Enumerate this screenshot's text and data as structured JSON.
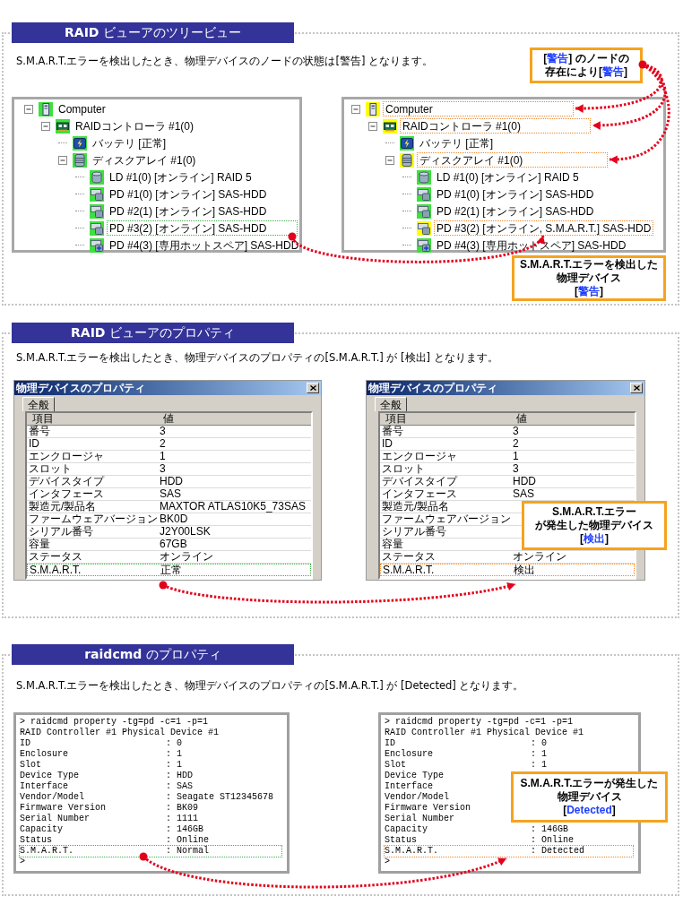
{
  "sections": [
    {
      "kind": "tree",
      "header": "**RAID** ビューアのツリービュー",
      "description": "S.M.A.R.T.エラーを検出したとき、物理デバイスのノードの状態は[警告] となります。",
      "node_callout": {
        "lines": [
          [
            {
              "text": "[",
              "accent": false
            },
            {
              "text": "警告",
              "accent": true
            },
            {
              "text": "] のノードの",
              "accent": false
            }
          ],
          [
            {
              "text": "存在により[",
              "accent": false
            },
            {
              "text": "警告",
              "accent": true
            },
            {
              "text": "]",
              "accent": false
            }
          ]
        ]
      },
      "panels": [
        {
          "kind": "before",
          "nodes": [
            {
              "label": "Computer",
              "kind": "computer",
              "warning": false,
              "expanded": true,
              "outlined": false,
              "children": [
                {
                  "label": "RAIDコントローラ #1(0)",
                  "kind": "controller",
                  "warning": false,
                  "expanded": true,
                  "outlined": false,
                  "children": [
                    {
                      "label": "バッテリ [正常]",
                      "kind": "battery",
                      "warning": false,
                      "outlined": false
                    },
                    {
                      "label": "ディスクアレイ #1(0)",
                      "kind": "array",
                      "warning": false,
                      "expanded": true,
                      "outlined": false,
                      "children": [
                        {
                          "label": "LD #1(0) [オンライン] RAID 5",
                          "kind": "logical_drive",
                          "warning": false,
                          "outlined": false
                        },
                        {
                          "label": "PD #1(0) [オンライン] SAS-HDD",
                          "kind": "drive",
                          "warning": false,
                          "outlined": false
                        },
                        {
                          "label": "PD #2(1) [オンライン] SAS-HDD",
                          "kind": "drive",
                          "warning": false,
                          "outlined": false
                        },
                        {
                          "label": "PD #3(2) [オンライン] SAS-HDD",
                          "kind": "drive",
                          "warning": false,
                          "outlined": true
                        },
                        {
                          "label": "PD #4(3) [専用ホットスペア] SAS-HDD",
                          "kind": "spare",
                          "warning": false,
                          "outlined": false
                        }
                      ]
                    }
                  ]
                }
              ]
            }
          ]
        },
        {
          "kind": "after",
          "nodes": [
            {
              "label": "Computer",
              "kind": "computer",
              "warning": true,
              "expanded": true,
              "outlined": true,
              "children": [
                {
                  "label": "RAIDコントローラ #1(0)",
                  "kind": "controller",
                  "warning": true,
                  "expanded": true,
                  "outlined": true,
                  "children": [
                    {
                      "label": "バッテリ [正常]",
                      "kind": "battery",
                      "warning": false,
                      "outlined": false
                    },
                    {
                      "label": "ディスクアレイ #1(0)",
                      "kind": "array",
                      "warning": true,
                      "expanded": true,
                      "outlined": true,
                      "children": [
                        {
                          "label": "LD #1(0) [オンライン] RAID 5",
                          "kind": "logical_drive",
                          "warning": false,
                          "outlined": false
                        },
                        {
                          "label": "PD #1(0) [オンライン] SAS-HDD",
                          "kind": "drive",
                          "warning": false,
                          "outlined": false
                        },
                        {
                          "label": "PD #2(1) [オンライン] SAS-HDD",
                          "kind": "drive",
                          "warning": false,
                          "outlined": false
                        },
                        {
                          "label": "PD #3(2) [オンライン, S.M.A.R.T.] SAS-HDD",
                          "kind": "drive",
                          "warning": true,
                          "outlined": true
                        },
                        {
                          "label": "PD #4(3) [専用ホットスペア] SAS-HDD",
                          "kind": "spare",
                          "warning": false,
                          "outlined": false
                        }
                      ]
                    }
                  ]
                }
              ]
            }
          ]
        }
      ],
      "device_callout": {
        "lines": [
          [
            {
              "text": "S.M.A.R.T.エラーを検出した",
              "accent": false
            }
          ],
          [
            {
              "text": "物理デバイス",
              "accent": false
            }
          ],
          [
            {
              "text": "[",
              "accent": false
            },
            {
              "text": "警告",
              "accent": true
            },
            {
              "text": "]",
              "accent": false
            }
          ]
        ]
      }
    },
    {
      "kind": "dialog",
      "header": "**RAID** ビューアのプロパティ",
      "description": "S.M.A.R.T.エラーを検出したとき、物理デバイスのプロパティの[S.M.A.R.T.] が [検出] となります。",
      "panels": [
        {
          "kind": "before",
          "title": "物理デバイスのプロパティ",
          "tabs": [
            {
              "label": "全般",
              "selected": true
            }
          ],
          "columns": [
            "項目",
            "値"
          ],
          "rows": [
            {
              "name": "番号",
              "value": "3",
              "outlined": false
            },
            {
              "name": "ID",
              "value": "2",
              "outlined": false
            },
            {
              "name": "エンクロージャ",
              "value": "1",
              "outlined": false
            },
            {
              "name": "スロット",
              "value": "3",
              "outlined": false
            },
            {
              "name": "デバイスタイプ",
              "value": "HDD",
              "outlined": false
            },
            {
              "name": "インタフェース",
              "value": "SAS",
              "outlined": false
            },
            {
              "name": "製造元/製品名",
              "value": "MAXTOR ATLAS10K5_73SAS",
              "outlined": false
            },
            {
              "name": "ファームウェアバージョン",
              "value": "BK0D",
              "outlined": false
            },
            {
              "name": "シリアル番号",
              "value": "J2Y00LSK",
              "outlined": false
            },
            {
              "name": "容量",
              "value": "67GB",
              "outlined": false
            },
            {
              "name": "ステータス",
              "value": "オンライン",
              "outlined": false
            },
            {
              "name": "S.M.A.R.T.",
              "value": "正常",
              "outlined": true
            }
          ]
        },
        {
          "kind": "after",
          "title": "物理デバイスのプロパティ",
          "tabs": [
            {
              "label": "全般",
              "selected": true
            }
          ],
          "columns": [
            "項目",
            "値"
          ],
          "rows": [
            {
              "name": "番号",
              "value": "3",
              "outlined": false
            },
            {
              "name": "ID",
              "value": "2",
              "outlined": false
            },
            {
              "name": "エンクロージャ",
              "value": "1",
              "outlined": false
            },
            {
              "name": "スロット",
              "value": "3",
              "outlined": false
            },
            {
              "name": "デバイスタイプ",
              "value": "HDD",
              "outlined": false
            },
            {
              "name": "インタフェース",
              "value": "SAS",
              "outlined": false
            },
            {
              "name": "製造元/製品名",
              "outlined": false
            },
            {
              "name": "ファームウェアバージョン",
              "outlined": false
            },
            {
              "name": "シリアル番号",
              "outlined": false
            },
            {
              "name": "容量",
              "outlined": false
            },
            {
              "name": "ステータス",
              "value": "オンライン",
              "outlined": false
            },
            {
              "name": "S.M.A.R.T.",
              "value": "検出",
              "outlined": true
            }
          ]
        }
      ],
      "device_callout": {
        "lines": [
          [
            {
              "text": "S.M.A.R.T.エラー",
              "accent": false
            }
          ],
          [
            {
              "text": "が発生した物理デバイス",
              "accent": false
            }
          ],
          [
            {
              "text": "[",
              "accent": false
            },
            {
              "text": "検出",
              "accent": true
            },
            {
              "text": "]",
              "accent": false
            }
          ]
        ]
      }
    },
    {
      "kind": "terminal",
      "header": "**raidcmd** のプロパティ",
      "description": "S.M.A.R.T.エラーを検出したとき、物理デバイスのプロパティの[S.M.A.R.T.] が [Detected] となります。",
      "panels": [
        {
          "kind": "before",
          "lines": [
            {
              "kind": "text",
              "text": "> raidcmd property -tg=pd -c=1 -p=1",
              "outlined": false
            },
            {
              "kind": "text",
              "text": "RAID Controller #1 Physical Device #1",
              "outlined": false
            },
            {
              "kind": "field",
              "label": "ID",
              "value": ": 0",
              "outlined": false
            },
            {
              "kind": "field",
              "label": "Enclosure",
              "value": ": 1",
              "outlined": false
            },
            {
              "kind": "field",
              "label": "Slot",
              "value": ": 1",
              "outlined": false
            },
            {
              "kind": "field",
              "label": "Device Type",
              "value": ": HDD",
              "outlined": false
            },
            {
              "kind": "field",
              "label": "Interface",
              "value": ": SAS",
              "outlined": false
            },
            {
              "kind": "field",
              "label": "Vendor/Model",
              "value": ": Seagate ST12345678",
              "outlined": false
            },
            {
              "kind": "field",
              "label": "Firmware Version",
              "value": ": BK09",
              "outlined": false
            },
            {
              "kind": "field",
              "label": "Serial Number",
              "value": ": 1111",
              "outlined": false
            },
            {
              "kind": "field",
              "label": "Capacity",
              "value": ": 146GB",
              "outlined": false
            },
            {
              "kind": "field",
              "label": "Status",
              "value": ": Online",
              "outlined": false
            },
            {
              "kind": "field",
              "label": "S.M.A.R.T.",
              "value": ": Normal",
              "outlined": true
            },
            {
              "kind": "text",
              "text": ">",
              "outlined": false
            }
          ]
        },
        {
          "kind": "after",
          "lines": [
            {
              "kind": "text",
              "text": "> raidcmd property -tg=pd -c=1 -p=1",
              "outlined": false
            },
            {
              "kind": "text",
              "text": "RAID Controller #1 Physical Device #1",
              "outlined": false
            },
            {
              "kind": "field",
              "label": "ID",
              "value": ": 0",
              "outlined": false
            },
            {
              "kind": "field",
              "label": "Enclosure",
              "value": ": 1",
              "outlined": false
            },
            {
              "kind": "field",
              "label": "Slot",
              "value": ": 1",
              "outlined": false
            },
            {
              "kind": "field",
              "label": "Device Type",
              "outlined": false
            },
            {
              "kind": "field",
              "label": "Interface",
              "outlined": false
            },
            {
              "kind": "field",
              "label": "Vendor/Model",
              "outlined": false
            },
            {
              "kind": "field",
              "label": "Firmware Version",
              "outlined": false
            },
            {
              "kind": "field",
              "label": "Serial Number",
              "outlined": false
            },
            {
              "kind": "field",
              "label": "Capacity",
              "value": ": 146GB",
              "outlined": false
            },
            {
              "kind": "field",
              "label": "Status",
              "value": ": Online",
              "outlined": false
            },
            {
              "kind": "field",
              "label": "S.M.A.R.T.",
              "value": ": Detected",
              "outlined": true
            },
            {
              "kind": "text",
              "text": ">",
              "outlined": false
            }
          ]
        }
      ],
      "device_callout": {
        "lines": [
          [
            {
              "text": "S.M.A.R.T.エラーが発生した",
              "accent": false
            }
          ],
          [
            {
              "text": "物理デバイス",
              "accent": false
            }
          ],
          [
            {
              "text": "[",
              "accent": false
            },
            {
              "text": "Detected",
              "accent": true
            },
            {
              "text": "]",
              "accent": false
            }
          ]
        ]
      }
    }
  ]
}
